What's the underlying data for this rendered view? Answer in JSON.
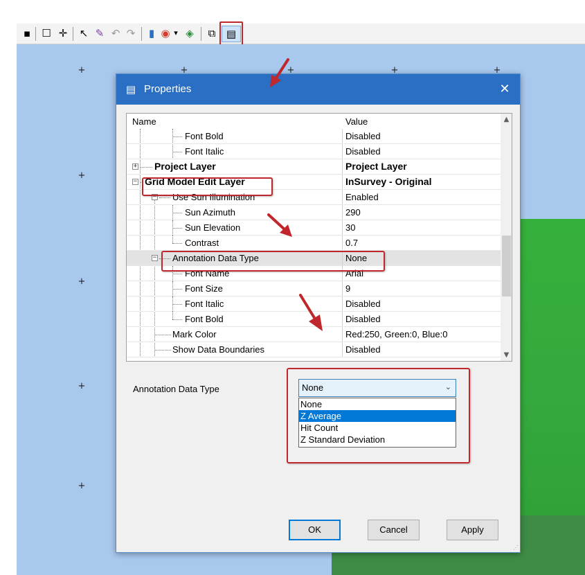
{
  "toolbar": {
    "icons": [
      {
        "name": "pan-icon",
        "glyph": "▪"
      },
      {
        "name": "rectangle-select-icon",
        "glyph": "☐"
      },
      {
        "name": "crosshair-icon",
        "glyph": "✛"
      },
      {
        "name": "pointer-icon",
        "glyph": "↖"
      },
      {
        "name": "edit-layer-icon",
        "glyph": "✎"
      },
      {
        "name": "undo-icon",
        "glyph": "↶"
      },
      {
        "name": "redo-icon",
        "glyph": "↷"
      },
      {
        "name": "color-bar-icon",
        "glyph": "▮"
      },
      {
        "name": "palette-icon",
        "glyph": "◉"
      },
      {
        "name": "dropdown-arrow-icon",
        "glyph": "▾"
      },
      {
        "name": "paint-icon",
        "glyph": "◈"
      },
      {
        "name": "windows-icon",
        "glyph": "⧉"
      },
      {
        "name": "properties-icon",
        "glyph": "▤"
      }
    ]
  },
  "dialog": {
    "title": "Properties",
    "title_icon": "▤",
    "close_glyph": "✕",
    "grid": {
      "col_name": "Name",
      "col_value": "Value",
      "rows": [
        {
          "label": "Font Bold",
          "value": "Disabled"
        },
        {
          "label": "Font Italic",
          "value": "Disabled"
        },
        {
          "label": "Project Layer",
          "value": "Project Layer"
        },
        {
          "label": "Grid Model Edit Layer",
          "value": "InSurvey - Original"
        },
        {
          "label": "Use Sun Illumination",
          "value": "Enabled"
        },
        {
          "label": "Sun Azimuth",
          "value": "290"
        },
        {
          "label": "Sun Elevation",
          "value": "30"
        },
        {
          "label": "Contrast",
          "value": "0.7"
        },
        {
          "label": "Annotation Data Type",
          "value": "None"
        },
        {
          "label": "Font Name",
          "value": "Arial"
        },
        {
          "label": "Font Size",
          "value": "9"
        },
        {
          "label": "Font Italic",
          "value": "Disabled"
        },
        {
          "label": "Font Bold",
          "value": "Disabled"
        },
        {
          "label": "Mark Color",
          "value": "Red:250, Green:0, Blue:0"
        },
        {
          "label": "Show Data Boundaries",
          "value": "Disabled"
        }
      ],
      "expand_plus": "+",
      "expand_minus": "−",
      "scroll_up": "▲",
      "scroll_down": "▼"
    },
    "editor": {
      "label": "Annotation Data Type",
      "selected": "None",
      "arrow": "⌄",
      "options": [
        "None",
        "Z Average",
        "Hit Count",
        "Z Standard Deviation"
      ],
      "highlighted_option": "Z Average"
    },
    "buttons": {
      "ok": "OK",
      "cancel": "Cancel",
      "apply": "Apply"
    },
    "grip": "⋰"
  },
  "map": {
    "cross_glyph": "+"
  },
  "colors": {
    "highlight": "#c0272d",
    "titlebar": "#2a6fc3",
    "map_blue": "#a8c8ee",
    "map_green": "#36b03c",
    "selection": "#0078d7"
  }
}
